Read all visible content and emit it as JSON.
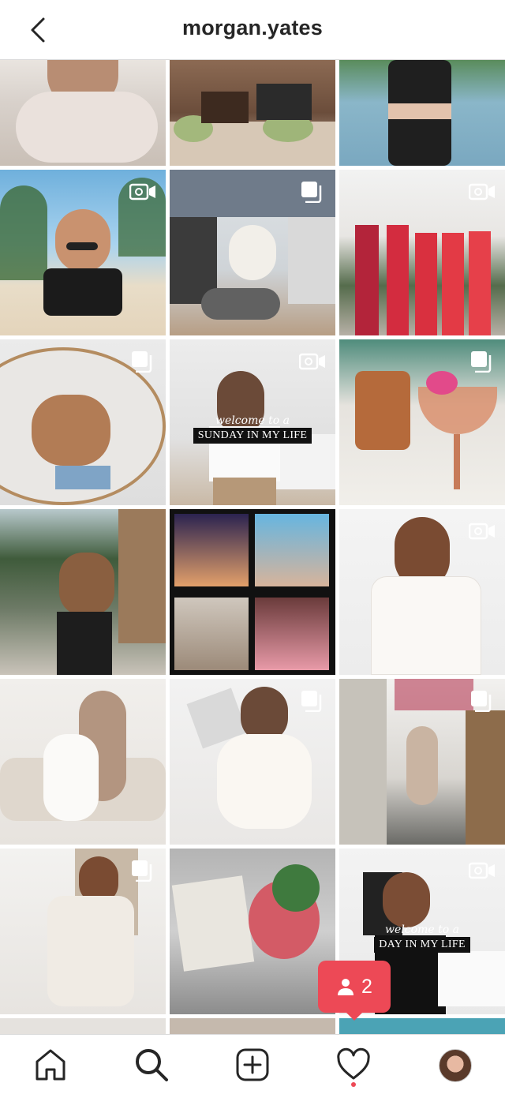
{
  "header": {
    "username": "morgan.yates",
    "back_icon": "chevron-left-icon"
  },
  "grid": {
    "rows": [
      [
        {
          "badge": "none"
        },
        {
          "badge": "none"
        },
        {
          "badge": "none"
        }
      ],
      [
        {
          "badge": "video"
        },
        {
          "badge": "carousel"
        },
        {
          "badge": "video"
        }
      ],
      [
        {
          "badge": "carousel"
        },
        {
          "badge": "video",
          "caption_script": "welcome to a",
          "caption_box": "SUNDAY IN MY LIFE"
        },
        {
          "badge": "carousel"
        }
      ],
      [
        {
          "badge": "none"
        },
        {
          "badge": "none"
        },
        {
          "badge": "video"
        }
      ],
      [
        {
          "badge": "none"
        },
        {
          "badge": "carousel"
        },
        {
          "badge": "carousel"
        }
      ],
      [
        {
          "badge": "carousel"
        },
        {
          "badge": "none"
        },
        {
          "badge": "video",
          "caption_script": "welcome to a",
          "caption_box": "DAY IN MY LIFE"
        }
      ]
    ]
  },
  "notification": {
    "icon": "person-icon",
    "count": "2",
    "color": "#ed4956"
  },
  "bottom_nav": {
    "items": [
      "home-icon",
      "search-icon",
      "new-post-icon",
      "activity-heart-icon",
      "profile-avatar"
    ]
  },
  "colors": {
    "accent": "#ed4956",
    "text": "#262626",
    "divider": "#dbdbdb"
  }
}
